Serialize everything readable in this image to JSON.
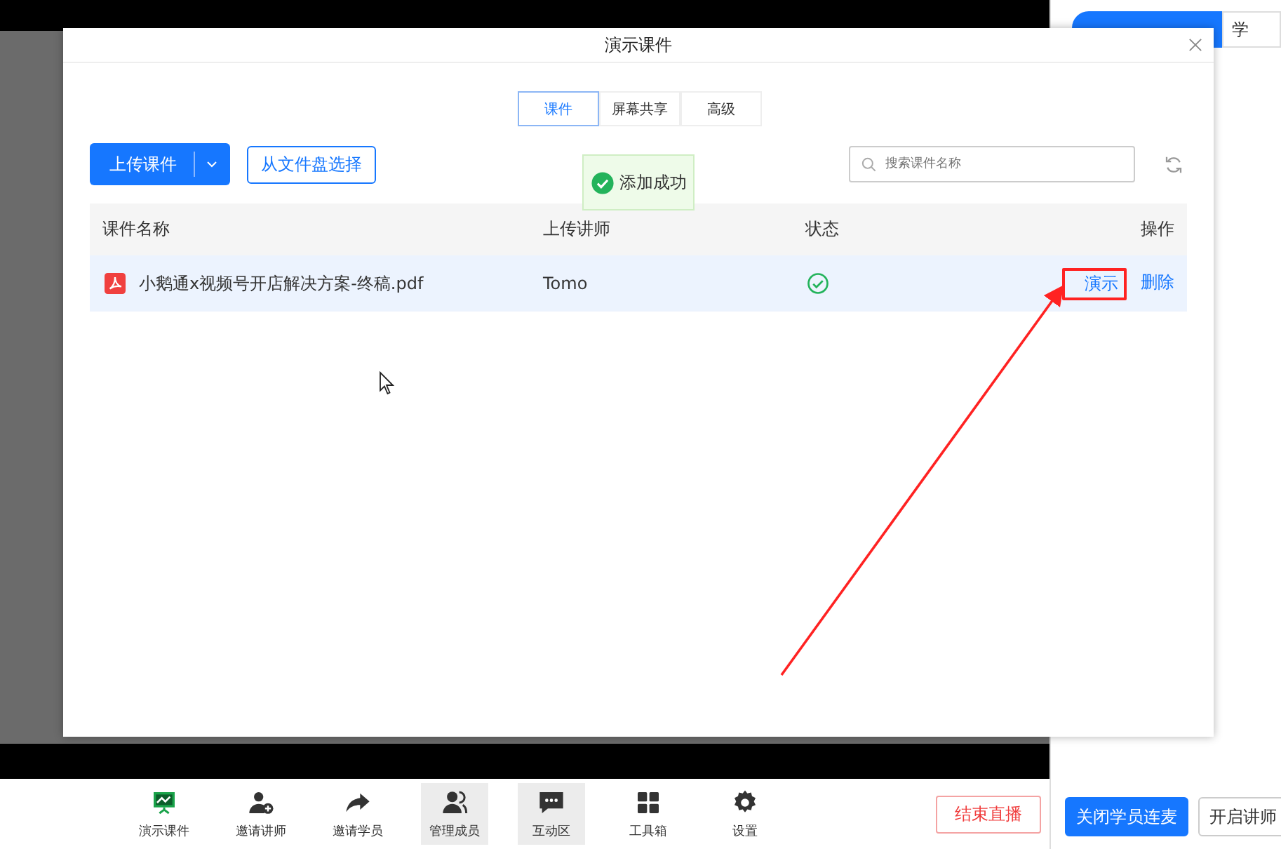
{
  "dialog": {
    "title": "演示课件",
    "tabs": [
      {
        "label": "课件",
        "selected": true
      },
      {
        "label": "屏幕共享",
        "selected": false
      },
      {
        "label": "高级",
        "selected": false
      }
    ],
    "upload_button": "上传课件",
    "file_disk_button": "从文件盘选择",
    "search": {
      "placeholder": "搜索课件名称"
    },
    "toast": "添加成功",
    "table": {
      "columns": [
        "课件名称",
        "上传讲师",
        "状态",
        "操作"
      ],
      "rows": [
        {
          "name": "小鹅通x视频号开店解决方案-终稿.pdf",
          "teacher": "Tomo",
          "done": true,
          "selected": true,
          "actions": [
            {
              "label": "演示",
              "highlighted": true
            },
            {
              "label": "删除",
              "highlighted": false
            }
          ]
        }
      ]
    }
  },
  "toolbar": [
    {
      "label": "演示课件",
      "selected": false
    },
    {
      "label": "邀请讲师",
      "selected": false
    },
    {
      "label": "邀请学员",
      "selected": false
    },
    {
      "label": "管理成员",
      "selected": true
    },
    {
      "label": "互动区",
      "selected": true
    },
    {
      "label": "工具箱",
      "selected": false
    },
    {
      "label": "设置",
      "selected": false
    }
  ],
  "end_button": "结束直播",
  "side_panel": {
    "tabs": [
      {
        "selected": true
      },
      {
        "label": "学",
        "selected": false
      }
    ],
    "buttons": [
      {
        "label": "关闭学员连麦",
        "primary": true
      },
      {
        "label": "开启讲师",
        "primary": false
      }
    ]
  }
}
